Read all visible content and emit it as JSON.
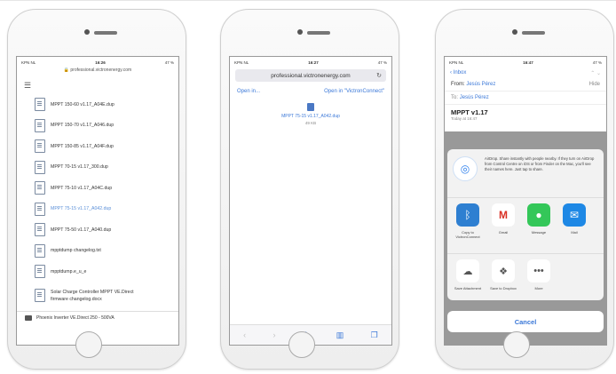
{
  "phone1": {
    "status": {
      "carrier": "KPN NL",
      "time": "16:26",
      "battery": "47 %"
    },
    "url": "professional.victronenergy.com",
    "files": [
      {
        "name": "MPPT 150-60 v1.17_A04E.dup",
        "selected": false
      },
      {
        "name": "MPPT 150-70 v1.17_A046.dup",
        "selected": false
      },
      {
        "name": "MPPT 150-85 v1.17_A04F.dup",
        "selected": false
      },
      {
        "name": "MPPT 70-15 v1.17_300.dup",
        "selected": false
      },
      {
        "name": "MPPT 75-10 v1.17_A04C.dup",
        "selected": false
      },
      {
        "name": "MPPT 75-15 v1.17_A042.dup",
        "selected": true
      },
      {
        "name": "MPPT 75-50 v1.17_A040.dup",
        "selected": false
      },
      {
        "name": "mpptdump changelog.txt",
        "selected": false
      },
      {
        "name": "mpptdump.e_u_e",
        "selected": false
      },
      {
        "name": "Solar Charge Controller MPPT VE.Direct firmware changelog.docx",
        "selected": false
      }
    ],
    "folder": "Phoenix Inverter VE.Direct 250 - 500VA"
  },
  "phone2": {
    "status": {
      "carrier": "KPN NL",
      "time": "16:27",
      "battery": "47 %"
    },
    "url": "professional.victronenergy.com",
    "open_in": "Open in...",
    "open_in_app": "Open in \"VictronConnect\"",
    "file_name": "MPPT 75-15 v1.17_A042.dup",
    "file_size": "49 KB"
  },
  "phone3": {
    "status": {
      "carrier": "KPN NL",
      "time": "16:47",
      "battery": "47 %"
    },
    "back": "Inbox",
    "from_label": "From:",
    "from_name": "Jesús Pérez",
    "hide": "Hide",
    "to_label": "To:",
    "to_name": "Jesús Pérez",
    "subject": "MPPT v1.17",
    "date": "Today at 16:47",
    "airdrop_text": "AirDrop. Share instantly with people nearby. If they turn on AirDrop from Control Centre on iOS or from Finder on the Mac, you'll see their names here. Just tap to share.",
    "apps": [
      {
        "label": "Copy to VictronConnect",
        "icon": "victronconnect-icon",
        "color": "#2e7fd1"
      },
      {
        "label": "Gmail",
        "icon": "gmail-icon",
        "color": "#ffffff"
      },
      {
        "label": "Message",
        "icon": "message-icon",
        "color": "#34c759"
      },
      {
        "label": "Mail",
        "icon": "mail-icon",
        "color": "#1e88e5"
      }
    ],
    "actions": [
      {
        "label": "Save Attachment",
        "icon": "cloud-icon"
      },
      {
        "label": "Save to Dropbox",
        "icon": "dropbox-icon"
      },
      {
        "label": "More",
        "icon": "more-icon"
      }
    ],
    "cancel": "Cancel"
  }
}
